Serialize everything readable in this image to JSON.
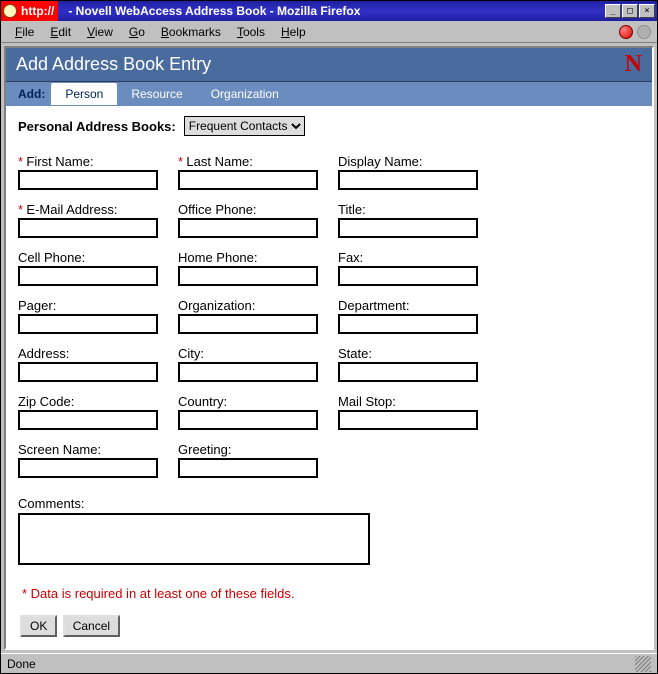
{
  "titlebar": {
    "url_prefix": "http://",
    "title": "- Novell WebAccess Address Book - Mozilla Firefox",
    "min": "_",
    "max": "□",
    "close": "×"
  },
  "menubar": {
    "file": "File",
    "edit": "Edit",
    "view": "View",
    "go": "Go",
    "bookmarks": "Bookmarks",
    "tools": "Tools",
    "help": "Help"
  },
  "header": {
    "title": "Add Address Book Entry",
    "logo": "N"
  },
  "tabs": {
    "label": "Add:",
    "person": "Person",
    "resource": "Resource",
    "organization": "Organization"
  },
  "toprow": {
    "label": "Personal Address Books:",
    "selected": "Frequent Contacts"
  },
  "req_marker": "*",
  "fields": {
    "first_name": {
      "label": "First Name:",
      "required": true,
      "value": ""
    },
    "last_name": {
      "label": "Last Name:",
      "required": true,
      "value": ""
    },
    "display_name": {
      "label": "Display Name:",
      "required": false,
      "value": ""
    },
    "email": {
      "label": "E-Mail Address:",
      "required": true,
      "value": ""
    },
    "office_phone": {
      "label": "Office Phone:",
      "required": false,
      "value": ""
    },
    "title": {
      "label": "Title:",
      "required": false,
      "value": ""
    },
    "cell_phone": {
      "label": "Cell Phone:",
      "required": false,
      "value": ""
    },
    "home_phone": {
      "label": "Home Phone:",
      "required": false,
      "value": ""
    },
    "fax": {
      "label": "Fax:",
      "required": false,
      "value": ""
    },
    "pager": {
      "label": "Pager:",
      "required": false,
      "value": ""
    },
    "organization": {
      "label": "Organization:",
      "required": false,
      "value": ""
    },
    "department": {
      "label": "Department:",
      "required": false,
      "value": ""
    },
    "address": {
      "label": "Address:",
      "required": false,
      "value": ""
    },
    "city": {
      "label": "City:",
      "required": false,
      "value": ""
    },
    "state": {
      "label": "State:",
      "required": false,
      "value": ""
    },
    "zip": {
      "label": "Zip Code:",
      "required": false,
      "value": ""
    },
    "country": {
      "label": "Country:",
      "required": false,
      "value": ""
    },
    "mail_stop": {
      "label": "Mail Stop:",
      "required": false,
      "value": ""
    },
    "screen_name": {
      "label": "Screen Name:",
      "required": false,
      "value": ""
    },
    "greeting": {
      "label": "Greeting:",
      "required": false,
      "value": ""
    }
  },
  "field_order": [
    "first_name",
    "last_name",
    "display_name",
    "email",
    "office_phone",
    "title",
    "cell_phone",
    "home_phone",
    "fax",
    "pager",
    "organization",
    "department",
    "address",
    "city",
    "state",
    "zip",
    "country",
    "mail_stop",
    "screen_name",
    "greeting"
  ],
  "comments": {
    "label": "Comments:",
    "value": ""
  },
  "note": "* Data is required in at least one of these fields.",
  "buttons": {
    "ok": "OK",
    "cancel": "Cancel"
  },
  "status": {
    "text": "Done"
  }
}
